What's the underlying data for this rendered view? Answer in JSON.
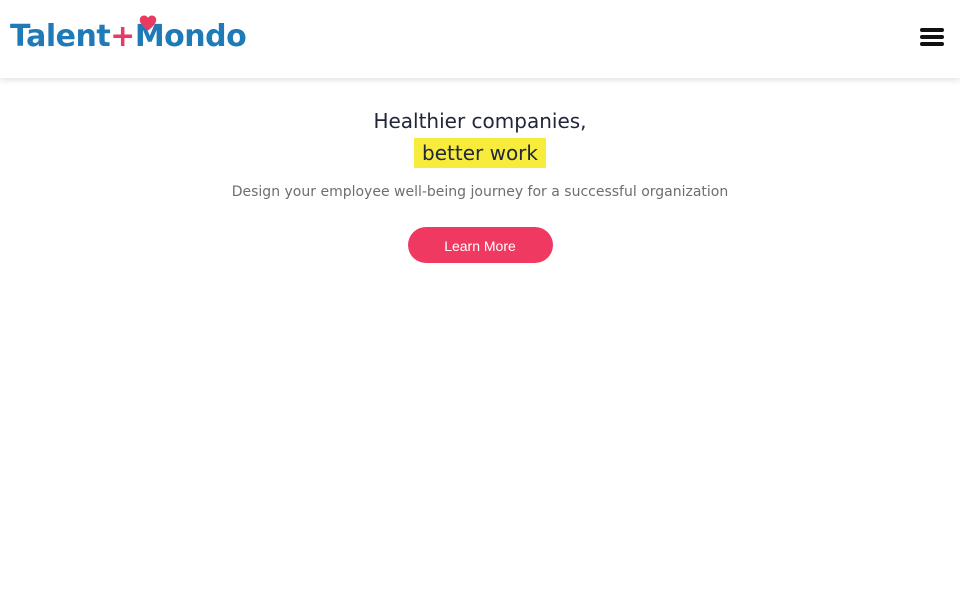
{
  "header": {
    "logo": {
      "part1": "Talent",
      "plus": "+",
      "m": "M",
      "part2": "ondo"
    },
    "menu_icon": "hamburger-menu-icon"
  },
  "hero": {
    "title_line1": "Healthier companies,",
    "title_highlight": "better work",
    "subtitle": "Design your employee well-being journey for a successful organization",
    "cta_label": "Learn More"
  },
  "colors": {
    "brand_blue": "#1f7ab8",
    "brand_pink": "#ef3961",
    "highlight_yellow": "#f7eb3c",
    "heading": "#222639"
  }
}
